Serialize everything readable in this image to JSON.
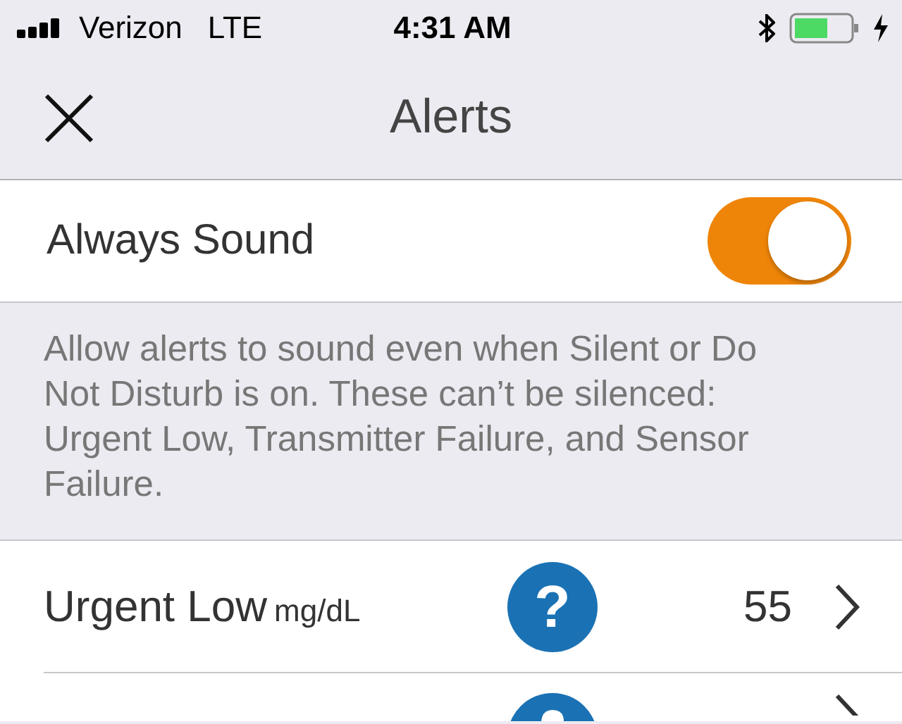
{
  "status_bar": {
    "carrier": "Verizon",
    "network": "LTE",
    "time": "4:31 AM"
  },
  "nav": {
    "title": "Alerts"
  },
  "always_sound": {
    "label": "Always Sound",
    "on": true
  },
  "description": "Allow alerts to sound even when Silent or Do Not Disturb is on. These can’t be silenced: Urgent Low, Transmitter Failure, and Sensor Failure.",
  "alerts": [
    {
      "kind": "full",
      "label": "Urgent Low",
      "unit": "mg/dL",
      "help": "?",
      "value": "55"
    },
    {
      "kind": "cut"
    }
  ]
}
